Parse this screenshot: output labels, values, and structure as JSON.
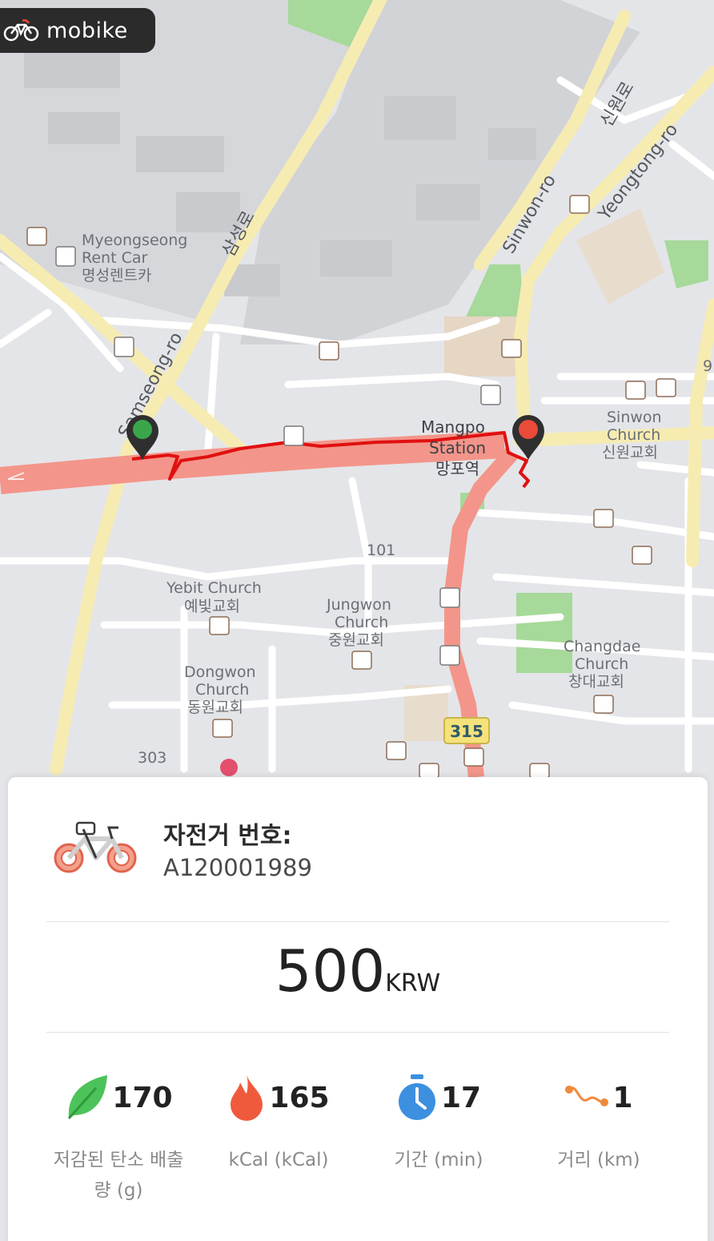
{
  "app": {
    "brand": "mobike"
  },
  "map": {
    "labels": {
      "myeongseong_en1": "Myeongseong",
      "myeongseong_en2": "Rent Car",
      "myeongseong_ko": "명성렌트카",
      "samseong_ko": "삼성로",
      "samseong_en": "Samseong-ro",
      "sinwon_ko": "신원로",
      "sinwon_en": "Sinwon-ro",
      "yeongtong_en": "Yeongtong-ro",
      "mangpo_en1": "Mangpo",
      "mangpo_en2": "Station",
      "mangpo_ko": "망포역",
      "sinwon_church_en1": "Sinwon",
      "sinwon_church_en2": "Church",
      "sinwon_church_ko": "신원교회",
      "yebit_en": "Yebit Church",
      "yebit_ko": "예빛교회",
      "jungwon_en1": "Jungwon",
      "jungwon_en2": "Church",
      "jungwon_ko": "중원교회",
      "dongwon_en1": "Dongwon",
      "dongwon_en2": "Church",
      "dongwon_ko": "동원교회",
      "changdae_en1": "Changdae",
      "changdae_en2": "Church",
      "changdae_ko": "창대교회",
      "road_101": "101",
      "road_303": "303",
      "road_315": "315",
      "edge_9": "9"
    },
    "colors": {
      "start_marker": "#3aa64a",
      "end_marker": "#ea4a3a",
      "route": "#e01010",
      "main_road": "#f3958a"
    }
  },
  "ride": {
    "bike_label": "자전거 번호:",
    "bike_id": "A120001989",
    "price": "500",
    "currency": "KRW",
    "stats": [
      {
        "icon": "leaf-icon",
        "value": "170",
        "label": "저감된 탄소 배출량 (g)"
      },
      {
        "icon": "flame-icon",
        "value": "165",
        "label": "kCal (kCal)"
      },
      {
        "icon": "stopwatch-icon",
        "value": "17",
        "label": "기간 (min)"
      },
      {
        "icon": "distance-icon",
        "value": "1",
        "label": "거리 (km)"
      }
    ]
  }
}
